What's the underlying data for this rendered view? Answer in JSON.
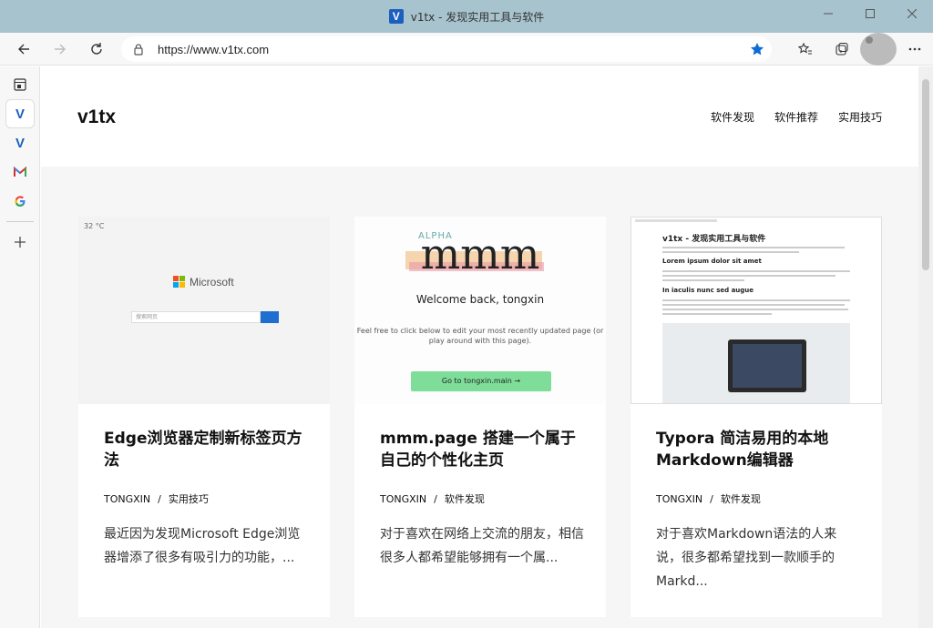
{
  "window": {
    "title": "v1tx - 发现实用工具与软件",
    "logo_letter": "V"
  },
  "browser": {
    "url": "https://www.v1tx.com"
  },
  "sidebar": {
    "items": [
      {
        "name": "v-tab-1",
        "letter": "V"
      },
      {
        "name": "v-tab-2",
        "letter": "V"
      },
      {
        "name": "gmail",
        "letter": "M"
      },
      {
        "name": "google",
        "letter": "G"
      }
    ]
  },
  "site": {
    "logo": "v1tx",
    "nav": [
      "软件发现",
      "软件推荐",
      "实用技巧"
    ]
  },
  "cards": [
    {
      "title": "Edge浏览器定制新标签页方法",
      "author": "TONGXIN",
      "category": "实用技巧",
      "excerpt": "最近因为发现Microsoft Edge浏览器增添了很多有吸引力的功能，...",
      "thumb": {
        "brand": "Microsoft",
        "temp": "32 °C",
        "search_placeholder": "搜索网页"
      }
    },
    {
      "title": "mmm.page 搭建一个属于自己的个性化主页",
      "author": "TONGXIN",
      "category": "软件发现",
      "excerpt": "对于喜欢在网络上交流的朋友，相信很多人都希望能够拥有一个属...",
      "thumb": {
        "alpha": "ALPHA",
        "logo": "mmm",
        "welcome": "Welcome back, tongxin",
        "hint": "Feel free to click below to edit your most recently updated page (or play around with this page).",
        "button": "Go to tongxin.main →"
      }
    },
    {
      "title": "Typora 简洁易用的本地Markdown编辑器",
      "author": "TONGXIN",
      "category": "软件发现",
      "excerpt": "对于喜欢Markdown语法的人来说，很多都希望找到一款顺手的Markd...",
      "thumb": {
        "h1": "v1tx - 发现实用工具与软件",
        "h2a": "Lorem ipsum dolor sit amet",
        "h2b": "In iaculis nunc sed augue"
      }
    }
  ],
  "meta_separator": "/",
  "colors": {
    "titlebar": "#a7c3cd",
    "accent_blue": "#1b5fbf",
    "star_blue": "#0f6cd6",
    "page_bg": "#f6f6f6"
  }
}
